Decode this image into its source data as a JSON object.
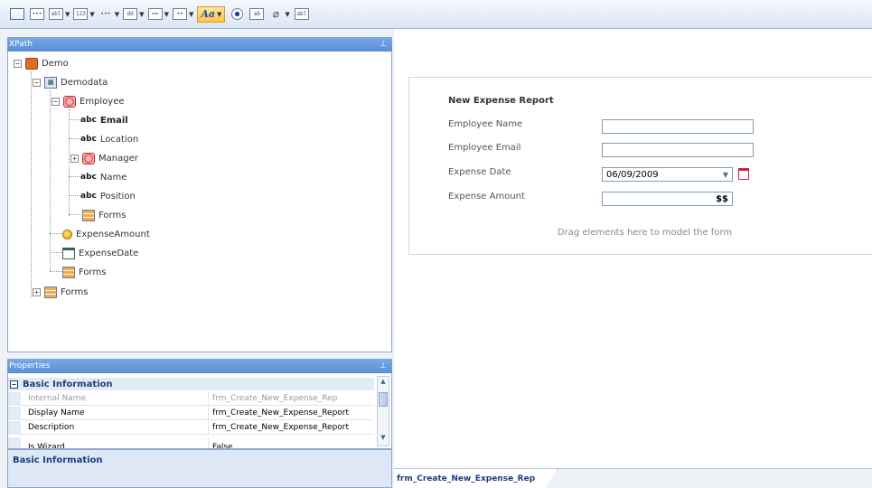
{
  "toolbar": {
    "items": [
      {
        "name": "form-icon",
        "glyph": "",
        "has_dropdown": false
      },
      {
        "name": "new-form-icon",
        "glyph": "•••",
        "has_dropdown": false
      },
      {
        "name": "textbox-icon",
        "glyph": "abl",
        "has_dropdown": true
      },
      {
        "name": "numeric-icon",
        "glyph": "123",
        "has_dropdown": true
      },
      {
        "name": "password-icon",
        "glyph": "•••",
        "has_dropdown": true
      },
      {
        "name": "datepicker-icon",
        "glyph": "dd",
        "has_dropdown": true
      },
      {
        "name": "grid-icon",
        "glyph": "==",
        "has_dropdown": true
      },
      {
        "name": "lookup-icon",
        "glyph": "++",
        "has_dropdown": true
      },
      {
        "name": "font-style-icon",
        "glyph": "Aa",
        "has_dropdown": true,
        "active": true
      },
      {
        "name": "radio-button-icon",
        "glyph": "",
        "has_dropdown": false
      },
      {
        "name": "label-icon",
        "glyph": "ab",
        "has_dropdown": false
      },
      {
        "name": "attachment-icon",
        "glyph": "Ū",
        "has_dropdown": true
      },
      {
        "name": "hidden-textbox-icon",
        "glyph": "abl",
        "has_dropdown": false
      }
    ]
  },
  "xpath_panel": {
    "title": "XPath",
    "tree": {
      "demo": "Demo",
      "demodata": "Demodata",
      "employee": "Employee",
      "email": "Email",
      "location": "Location",
      "manager": "Manager",
      "name": "Name",
      "position": "Position",
      "forms_employee": "Forms",
      "expense_amount": "ExpenseAmount",
      "expense_date": "ExpenseDate",
      "forms_demodata": "Forms",
      "forms_root": "Forms"
    },
    "abc_prefix": "abc"
  },
  "properties_panel": {
    "title": "Properties",
    "category": "Basic Information",
    "rows": [
      {
        "label": "Internal Name",
        "value": "frm_Create_New_Expense_Rep"
      },
      {
        "label": "Display Name",
        "value": "frm_Create_New_Expense_Report"
      },
      {
        "label": "Description",
        "value": "frm_Create_New_Expense_Report"
      },
      {
        "label": "Is Wizard",
        "value": "False"
      }
    ],
    "description_title": "Basic Information"
  },
  "form": {
    "title": "New Expense Report",
    "fields": [
      {
        "label": "Employee Name",
        "value": ""
      },
      {
        "label": "Employee Email",
        "value": ""
      },
      {
        "label": "Expense Date",
        "value": "06/09/2009"
      },
      {
        "label": "Expense Amount",
        "value": "$$"
      }
    ],
    "drag_hint": "Drag elements here to model the form"
  },
  "tabs": [
    {
      "label": "frm_Create_New_Expense_Rep"
    }
  ],
  "colors": {
    "panel_header": "#5b8ed6",
    "toolbar_bg": "#dbe6f4",
    "accent_active": "#ffc24a"
  }
}
